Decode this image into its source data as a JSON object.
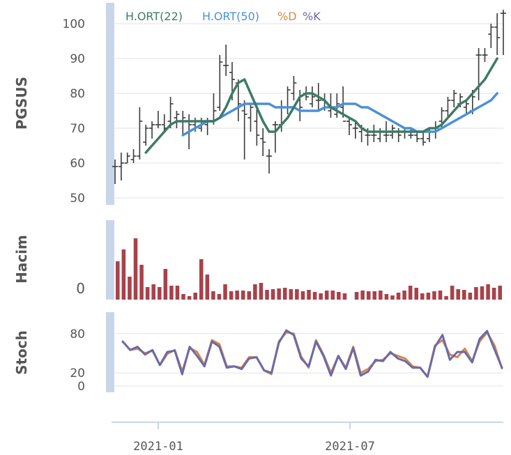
{
  "chart_data": {
    "type": "stock",
    "x_ticks": [
      "2021-01",
      "2021-07"
    ],
    "colors": {
      "ohlc": "#3a3a3a",
      "ma22": "#3d7a68",
      "ma50": "#4a90d9",
      "volume": "#a8424a",
      "d": "#d4884a",
      "k": "#6a6aaa",
      "axis_bar": "#c9d6ea",
      "grid": "#e2e2e2",
      "text": "#555555"
    },
    "price_panel": {
      "ylabel": "PGSUS",
      "y_ticks": [
        50,
        60,
        70,
        80,
        90,
        100
      ],
      "ylim": [
        48,
        106
      ],
      "legend": [
        {
          "label": "H.ORT(22)",
          "color": "#3d7a68"
        },
        {
          "label": "H.ORT(50)",
          "color": "#4a90d9"
        },
        {
          "label": "%D",
          "color": "#d4884a"
        },
        {
          "label": "%K",
          "color": "#6a6aaa"
        }
      ],
      "ohlc": [
        [
          59,
          61,
          54,
          59
        ],
        [
          59,
          63,
          55,
          60
        ],
        [
          60,
          63,
          60,
          62
        ],
        [
          61,
          64,
          60,
          62
        ],
        [
          62,
          76,
          61,
          72
        ],
        [
          66,
          71,
          65,
          70
        ],
        [
          70,
          72,
          67,
          71
        ],
        [
          71,
          75,
          70,
          71
        ],
        [
          71,
          74,
          69,
          70
        ],
        [
          72,
          79,
          70,
          77
        ],
        [
          73,
          75,
          70,
          74
        ],
        [
          72,
          75,
          68,
          73
        ],
        [
          72,
          74,
          64,
          71
        ],
        [
          71,
          73,
          69,
          72
        ],
        [
          70,
          73,
          69,
          72
        ],
        [
          71,
          73,
          68,
          72
        ],
        [
          72,
          80,
          71,
          75
        ],
        [
          76,
          91,
          75,
          89
        ],
        [
          88,
          94,
          85,
          88
        ],
        [
          86,
          89,
          78,
          84
        ],
        [
          83,
          84,
          72,
          77
        ],
        [
          75,
          78,
          61,
          74
        ],
        [
          73,
          77,
          69,
          76
        ],
        [
          72,
          76,
          65,
          68
        ],
        [
          67,
          70,
          62,
          66
        ],
        [
          62,
          64,
          57,
          62
        ],
        [
          71,
          72,
          63,
          71
        ],
        [
          71,
          78,
          69,
          76
        ],
        [
          76,
          82,
          74,
          81
        ],
        [
          80,
          85,
          78,
          83
        ],
        [
          78,
          81,
          72,
          76
        ],
        [
          80,
          82,
          78,
          79
        ],
        [
          77,
          82,
          76,
          79
        ],
        [
          78,
          83,
          75,
          78
        ],
        [
          78,
          80,
          75,
          76
        ],
        [
          75,
          80,
          73,
          76
        ],
        [
          74,
          80,
          73,
          77
        ],
        [
          76,
          82,
          73,
          72
        ],
        [
          72,
          73,
          68,
          71
        ],
        [
          70,
          72,
          67,
          70
        ],
        [
          69,
          71,
          66,
          70
        ],
        [
          68,
          70,
          65,
          68
        ],
        [
          68,
          71,
          66,
          68
        ],
        [
          67,
          70,
          66,
          69
        ],
        [
          68,
          72,
          66,
          68
        ],
        [
          68,
          71,
          67,
          70
        ],
        [
          69,
          70,
          66,
          68
        ],
        [
          69,
          70,
          67,
          69
        ],
        [
          68,
          70,
          67,
          68
        ],
        [
          68,
          69,
          66,
          67
        ],
        [
          67,
          69,
          65,
          66
        ],
        [
          67,
          70,
          66,
          69
        ],
        [
          70,
          72,
          67,
          70
        ],
        [
          72,
          76,
          70,
          75
        ],
        [
          75,
          79,
          73,
          78
        ],
        [
          78,
          81,
          76,
          80
        ],
        [
          77,
          80,
          76,
          79
        ],
        [
          76,
          78,
          74,
          77
        ],
        [
          75,
          81,
          74,
          79
        ],
        [
          91,
          93,
          78,
          91
        ],
        [
          91,
          93,
          89,
          91
        ],
        [
          97,
          100,
          93,
          99
        ],
        [
          99,
          103,
          91,
          96
        ],
        [
          103,
          104,
          91,
          103
        ]
      ],
      "ma22": [
        null,
        null,
        null,
        null,
        null,
        63,
        65,
        67,
        69,
        71,
        72,
        72,
        72,
        72,
        72,
        72,
        72,
        73,
        76,
        80,
        83,
        84,
        80,
        76,
        72,
        69,
        69,
        71,
        73,
        76,
        79,
        80,
        80,
        79,
        78,
        76,
        75,
        74,
        73,
        72,
        70,
        69,
        69,
        69,
        69,
        69,
        69,
        69,
        69,
        69,
        69,
        70,
        70,
        71,
        73,
        75,
        77,
        78,
        80,
        82,
        84,
        87,
        90
      ],
      "ma50": [
        null,
        null,
        null,
        null,
        null,
        null,
        null,
        null,
        null,
        null,
        null,
        68,
        69,
        70,
        71,
        72,
        72,
        73,
        74,
        75,
        76,
        77,
        77,
        77,
        77,
        77,
        76,
        76,
        76,
        76,
        75,
        75,
        75,
        75,
        76,
        76,
        76,
        77,
        77,
        77,
        76,
        76,
        75,
        74,
        73,
        72,
        71,
        70,
        70,
        69,
        69,
        69,
        69,
        70,
        71,
        72,
        73,
        74,
        75,
        76,
        77,
        78,
        80
      ]
    },
    "volume_panel": {
      "ylabel": "Hacim",
      "y_tick_label": "0",
      "values": [
        55,
        72,
        33,
        88,
        50,
        18,
        22,
        18,
        44,
        20,
        20,
        8,
        5,
        10,
        58,
        36,
        12,
        8,
        22,
        12,
        13,
        13,
        12,
        22,
        24,
        14,
        15,
        16,
        17,
        15,
        15,
        12,
        14,
        11,
        9,
        13,
        13,
        11,
        9,
        0,
        11,
        13,
        12,
        12,
        13,
        8,
        6,
        10,
        13,
        20,
        17,
        9,
        10,
        12,
        13,
        5,
        20,
        15,
        14,
        10,
        18,
        19,
        22,
        17,
        20
      ],
      "ymax": 100
    },
    "stoch_panel": {
      "ylabel": "Stoch",
      "y_ticks": [
        0,
        20,
        80
      ],
      "ylim": [
        0,
        100
      ],
      "d": [
        68,
        55,
        57,
        50,
        54,
        32,
        49,
        55,
        22,
        58,
        52,
        32,
        70,
        64,
        30,
        30,
        28,
        44,
        44,
        24,
        18,
        68,
        82,
        80,
        45,
        28,
        70,
        48,
        20,
        46,
        28,
        60,
        20,
        26,
        38,
        40,
        50,
        46,
        42,
        30,
        28,
        14,
        62,
        70,
        48,
        44,
        57,
        38,
        68,
        82,
        62,
        27
      ],
      "k": [
        68,
        55,
        60,
        48,
        55,
        32,
        52,
        54,
        18,
        60,
        46,
        30,
        68,
        60,
        28,
        30,
        26,
        42,
        44,
        24,
        20,
        66,
        85,
        78,
        42,
        30,
        68,
        46,
        16,
        46,
        26,
        58,
        16,
        22,
        40,
        38,
        52,
        42,
        38,
        28,
        28,
        14,
        60,
        78,
        40,
        52,
        52,
        36,
        72,
        84,
        56,
        28
      ]
    }
  }
}
